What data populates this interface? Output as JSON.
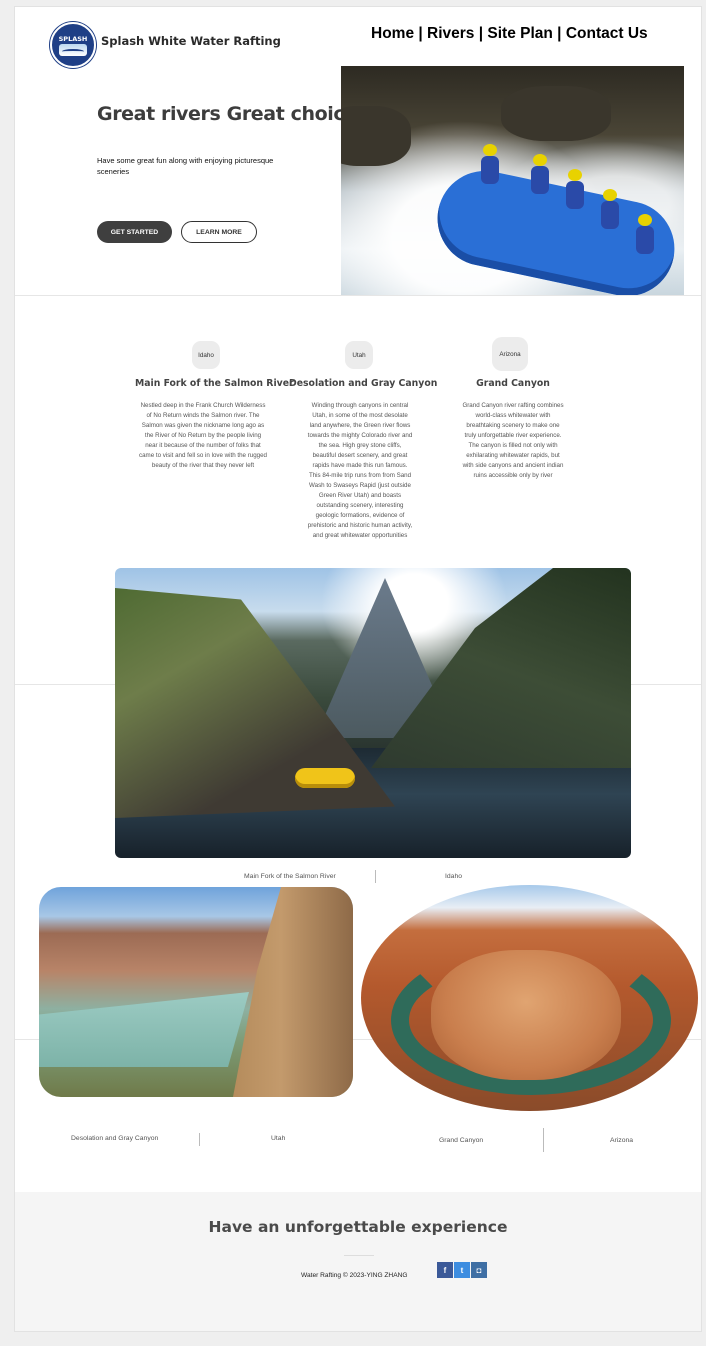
{
  "header": {
    "logo_text": "SPLASH",
    "brand": "Splash White Water Rafting",
    "nav": [
      "Home",
      "Rivers",
      "Site Plan",
      "Contact Us"
    ],
    "nav_separator": " | "
  },
  "hero": {
    "title": "Great rivers Great choice",
    "subtitle": "Have some great fun along with enjoying picturesque sceneries",
    "cta_primary": "GET STARTED",
    "cta_secondary": "LEARN MORE",
    "image": "white-water-rafting-photo"
  },
  "rivers": [
    {
      "state": "Idaho",
      "name": "Main Fork of the Salmon River",
      "description": "Nestled deep in the Frank Church Wilderness of No Return winds the Salmon river. The Salmon was given the nickname long ago as the River of No Return by the people living near it because of the number of folks that came to visit and fell so in love with the rugged beauty of the river that they never left"
    },
    {
      "state": "Utah",
      "name": "Desolation and Gray Canyon",
      "description": "Winding through canyons in central Utah, in some of the most desolate land anywhere, the Green river flows towards the mighty Colorado river and the sea. High grey stone cliffs, beautiful desert scenery, and great rapids have made this run famous. This 84-mile trip runs from from Sand Wash to Swaseys Rapid (just outside Green River Utah) and boasts outstanding scenery, interesting geologic formations, evidence of prehistoric and historic human activity, and great whitewater opportunities"
    },
    {
      "state": "Arizona",
      "name": "Grand Canyon",
      "description": "Grand Canyon river rafting combines world-class whitewater with breathtaking scenery to make one truly unforgettable river experience. The canyon is filled not only with exhilarating whitewater rapids, but with side canyons and ancient indian ruins accessible only by river"
    }
  ],
  "gallery": {
    "salmon": {
      "name": "Main Fork of the Salmon River",
      "state": "Idaho"
    },
    "utah": {
      "name": "Desolation and Gray Canyon",
      "state": "Utah"
    },
    "gc": {
      "name": "Grand Canyon",
      "state": "Arizona"
    }
  },
  "footer": {
    "title": "Have an unforgettable experience",
    "copyright": "Water Rafting © 2023-YING ZHANG",
    "social": {
      "facebook": "f",
      "twitter": "t",
      "instagram": "◘"
    }
  }
}
